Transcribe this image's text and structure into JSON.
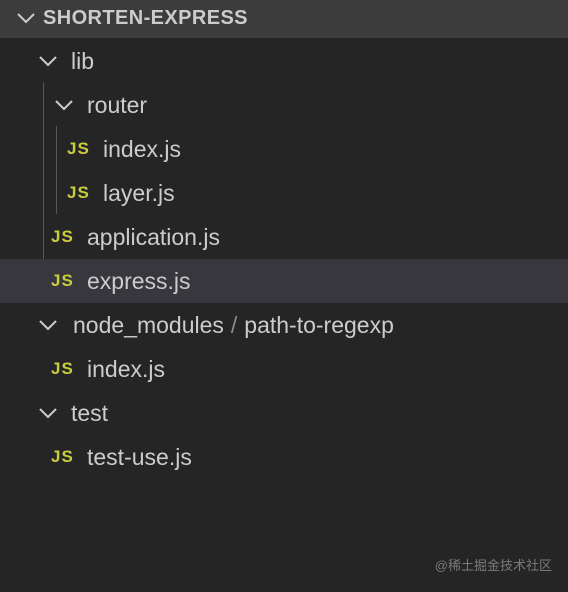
{
  "explorer": {
    "section_title": "SHORTEN-EXPRESS",
    "tree": [
      {
        "kind": "folder",
        "label": "lib",
        "icon": "chevron-down-icon"
      },
      {
        "kind": "folder",
        "label": "router",
        "icon": "chevron-down-icon"
      },
      {
        "kind": "file",
        "label": "index.js",
        "badge": "JS"
      },
      {
        "kind": "file",
        "label": "layer.js",
        "badge": "JS"
      },
      {
        "kind": "file",
        "label": "application.js",
        "badge": "JS"
      },
      {
        "kind": "file",
        "label": "express.js",
        "badge": "JS",
        "selected": true
      },
      {
        "kind": "folder",
        "label": "node_modules",
        "separator": "/",
        "label2": "path-to-regexp",
        "icon": "chevron-down-icon"
      },
      {
        "kind": "file",
        "label": "index.js",
        "badge": "JS"
      },
      {
        "kind": "folder",
        "label": "test",
        "icon": "chevron-down-icon"
      },
      {
        "kind": "file",
        "label": "test-use.js",
        "badge": "JS"
      }
    ]
  },
  "watermark": "@稀土掘金技术社区",
  "colors": {
    "background": "#252526",
    "header": "#3c3c3c",
    "selected_row": "#37373d",
    "js_badge": "#cbcb41",
    "text": "#cccccc"
  }
}
